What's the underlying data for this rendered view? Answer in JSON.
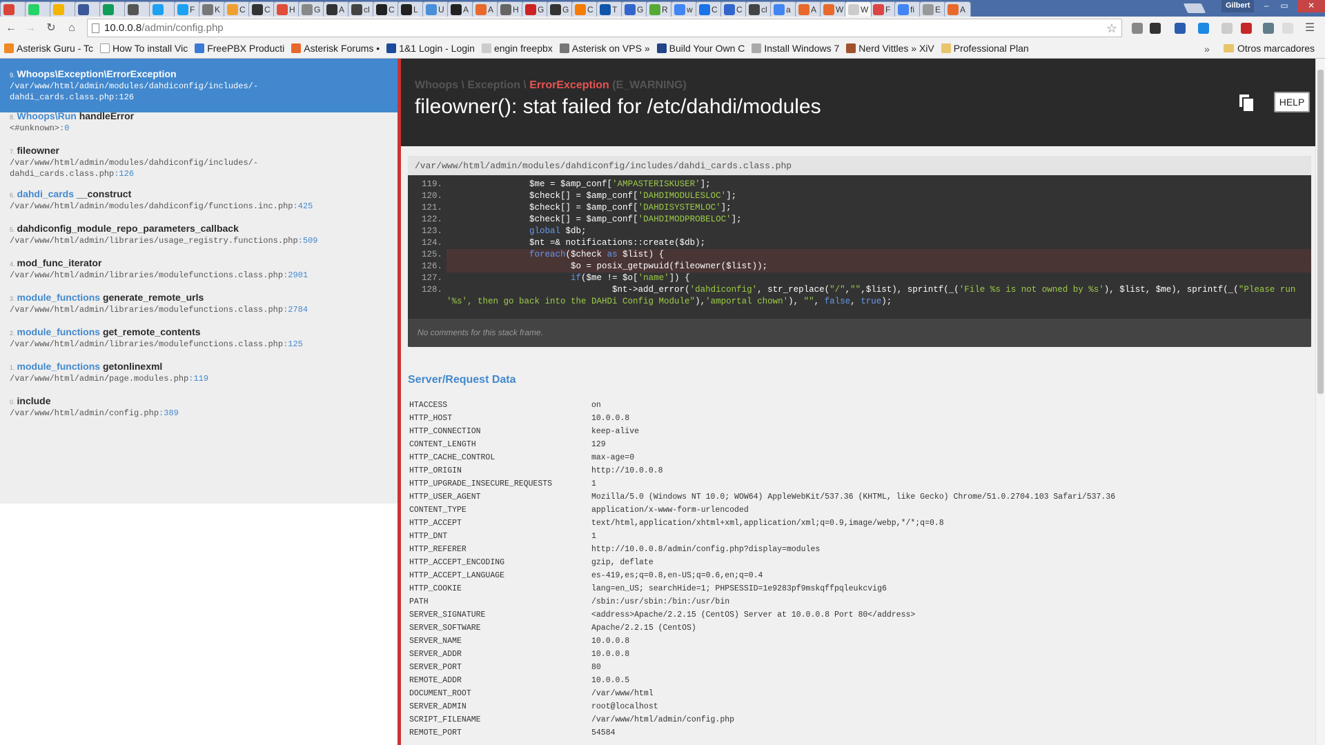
{
  "browser": {
    "profile": "Gilbert",
    "window_controls": [
      "–",
      "▭",
      "✕"
    ],
    "tabs": [
      {
        "label": "",
        "color": "#db4437"
      },
      {
        "label": "",
        "color": "#25d366"
      },
      {
        "label": "",
        "color": "#f4b400"
      },
      {
        "label": "",
        "color": "#3b5998"
      },
      {
        "label": "",
        "color": "#0f9d58"
      },
      {
        "label": "",
        "color": "#555555"
      },
      {
        "label": "",
        "color": "#1da1f2"
      },
      {
        "label": "F",
        "color": "#1da1f2"
      },
      {
        "label": "K",
        "color": "#777777"
      },
      {
        "label": "C",
        "color": "#f0a030"
      },
      {
        "label": "C",
        "color": "#333333"
      },
      {
        "label": "H",
        "color": "#e04e39"
      },
      {
        "label": "G",
        "color": "#888888"
      },
      {
        "label": "A",
        "color": "#333333"
      },
      {
        "label": "cl",
        "color": "#444444"
      },
      {
        "label": "C",
        "color": "#222222"
      },
      {
        "label": "L",
        "color": "#222222"
      },
      {
        "label": "U",
        "color": "#4a90d9"
      },
      {
        "label": "A",
        "color": "#222222"
      },
      {
        "label": "A",
        "color": "#e8692b"
      },
      {
        "label": "H",
        "color": "#666666"
      },
      {
        "label": "G",
        "color": "#cc2222"
      },
      {
        "label": "G",
        "color": "#333333"
      },
      {
        "label": "C",
        "color": "#f57c00"
      },
      {
        "label": "T",
        "color": "#1155aa"
      },
      {
        "label": "G",
        "color": "#3366cc"
      },
      {
        "label": "R",
        "color": "#55aa33"
      },
      {
        "label": "w",
        "color": "#4285f4"
      },
      {
        "label": "C",
        "color": "#1a73e8"
      },
      {
        "label": "C",
        "color": "#3366cc"
      },
      {
        "label": "cl",
        "color": "#444444"
      },
      {
        "label": "a",
        "color": "#4285f4"
      },
      {
        "label": "A",
        "color": "#e8692b"
      },
      {
        "label": "W",
        "color": "#e8692b"
      },
      {
        "label": "W",
        "color": "#cccccc",
        "active": true
      },
      {
        "label": "F",
        "color": "#dd4444"
      },
      {
        "label": "fi",
        "color": "#4285f4"
      },
      {
        "label": "E",
        "color": "#999999"
      },
      {
        "label": "A",
        "color": "#e8692b"
      }
    ],
    "url_host": "10.0.0.8",
    "url_path": "/admin/config.php",
    "bookmarks": [
      {
        "label": "Asterisk Guru - Tc",
        "color": "#f08a24"
      },
      {
        "label": "How To install Vic",
        "color": "#ffffff"
      },
      {
        "label": "FreePBX Producti",
        "color": "#3a7bd5"
      },
      {
        "label": "Asterisk Forums •",
        "color": "#e8692b"
      },
      {
        "label": "1&1 Login - Login",
        "color": "#1c4a9c"
      },
      {
        "label": "engin freepbx",
        "color": "#cccccc"
      },
      {
        "label": "Asterisk on VPS »",
        "color": "#777777"
      },
      {
        "label": "Build Your Own C",
        "color": "#224488"
      },
      {
        "label": "Install Windows 7",
        "color": "#aaaaaa"
      },
      {
        "label": "Nerd Vittles » XiV",
        "color": "#a0522d"
      },
      {
        "label": "Professional Plan",
        "color": "#e8c46a"
      }
    ],
    "bookmarks_overflow": "»",
    "other_bookmarks": "Otros marcadores"
  },
  "frames": [
    {
      "index": "9.",
      "class": "Whoops\\Exception\\ErrorException",
      "func": "",
      "file": "/var/www/html/admin/modules/dahdiconfig/includes/-",
      "file2": "dahdi_cards.class.php",
      "line": ":126"
    },
    {
      "index": "8.",
      "class": "Whoops\\Run",
      "func": " handleError",
      "file": "<#unknown>",
      "file2": "",
      "line": ":0"
    },
    {
      "index": "7.",
      "class": "",
      "func": "fileowner",
      "file": "/var/www/html/admin/modules/dahdiconfig/includes/-",
      "file2": "dahdi_cards.class.php",
      "line": ":126"
    },
    {
      "index": "6.",
      "class": "dahdi_cards",
      "func": " __construct",
      "file": "/var/www/html/admin/modules/dahdiconfig/functions.inc.php",
      "file2": "",
      "line": ":425"
    },
    {
      "index": "5.",
      "class": "",
      "func": "dahdiconfig_module_repo_parameters_callback",
      "file": "/var/www/html/admin/libraries/usage_registry.functions.php",
      "file2": "",
      "line": ":509"
    },
    {
      "index": "4.",
      "class": "",
      "func": "mod_func_iterator",
      "file": "/var/www/html/admin/libraries/modulefunctions.class.php",
      "file2": "",
      "line": ":2901"
    },
    {
      "index": "3.",
      "class": "module_functions",
      "func": " generate_remote_urls",
      "file": "/var/www/html/admin/libraries/modulefunctions.class.php",
      "file2": "",
      "line": ":2784"
    },
    {
      "index": "2.",
      "class": "module_functions",
      "func": " get_remote_contents",
      "file": "/var/www/html/admin/libraries/modulefunctions.class.php",
      "file2": "",
      "line": ":125"
    },
    {
      "index": "1.",
      "class": "module_functions",
      "func": " getonlinexml",
      "file": "/var/www/html/admin/page.modules.php",
      "file2": "",
      "line": ":119"
    },
    {
      "index": "0.",
      "class": "",
      "func": "include",
      "file": "/var/www/html/admin/config.php",
      "file2": "",
      "line": ":389"
    }
  ],
  "exception": {
    "ns": "Whoops \\ Exception \\ ",
    "name": "ErrorException",
    "level": " (E_WARNING)",
    "message": "fileowner(): stat failed for /etc/dahdi/modules",
    "help_label": "HELP"
  },
  "code": {
    "file": "/var/www/html/admin/modules/dahdiconfig/includes/dahdi_cards.class.php",
    "lines": [
      {
        "n": "119.",
        "html": "                $me = $amp_conf[<span class=\"str\">'AMPASTERISKUSER'</span>];"
      },
      {
        "n": "120.",
        "html": "                $check[] = $amp_conf[<span class=\"str\">'DAHDIMODULESLOC'</span>];"
      },
      {
        "n": "121.",
        "html": "                $check[] = $amp_conf[<span class=\"str\">'DAHDISYSTEMLOC'</span>];"
      },
      {
        "n": "122.",
        "html": "                $check[] = $amp_conf[<span class=\"str\">'DAHDIMODPROBELOC'</span>];"
      },
      {
        "n": "123.",
        "html": "                <span class=\"kw\">global</span> $db;"
      },
      {
        "n": "124.",
        "html": "                $nt =& notifications::create($db);"
      },
      {
        "n": "125.",
        "html": "                <span class=\"kw\">foreach</span>($check <span class=\"kw\">as</span> $list) {",
        "hl": true
      },
      {
        "n": "126.",
        "html": "                        $o = posix_getpwuid(fileowner($list));",
        "hl": true
      },
      {
        "n": "127.",
        "html": "                        <span class=\"kw\">if</span>($me != $o[<span class=\"str\">'name'</span>]) {"
      },
      {
        "n": "128.",
        "html": "                                $nt->add_error(<span class=\"str\">'dahdiconfig'</span>, str_replace(<span class=\"str\">\"/\"</span>,<span class=\"str\">\"\"</span>,$list), sprintf(_(<span class=\"str\">'File %s is not owned by %s'</span>), $list, $me), sprintf(_(<span class=\"str\">\"Please run '%s', then go back into the DAHDi Config Module\"</span>),<span class=\"str\">'amportal chown'</span>), <span class=\"str\">\"\"</span>, <span class=\"kw\">false</span>, <span class=\"kw\">true</span>);"
      }
    ],
    "comments": "No comments for this stack frame."
  },
  "server": {
    "title": "Server/Request Data",
    "rows": [
      [
        "HTACCESS",
        "on"
      ],
      [
        "HTTP_HOST",
        "10.0.0.8"
      ],
      [
        "HTTP_CONNECTION",
        "keep-alive"
      ],
      [
        "CONTENT_LENGTH",
        "129"
      ],
      [
        "HTTP_CACHE_CONTROL",
        "max-age=0"
      ],
      [
        "HTTP_ORIGIN",
        "http://10.0.0.8"
      ],
      [
        "HTTP_UPGRADE_INSECURE_REQUESTS",
        "1"
      ],
      [
        "HTTP_USER_AGENT",
        "Mozilla/5.0 (Windows NT 10.0; WOW64) AppleWebKit/537.36 (KHTML, like Gecko) Chrome/51.0.2704.103 Safari/537.36"
      ],
      [
        "CONTENT_TYPE",
        "application/x-www-form-urlencoded"
      ],
      [
        "HTTP_ACCEPT",
        "text/html,application/xhtml+xml,application/xml;q=0.9,image/webp,*/*;q=0.8"
      ],
      [
        "HTTP_DNT",
        "1"
      ],
      [
        "HTTP_REFERER",
        "http://10.0.0.8/admin/config.php?display=modules"
      ],
      [
        "HTTP_ACCEPT_ENCODING",
        "gzip, deflate"
      ],
      [
        "HTTP_ACCEPT_LANGUAGE",
        "es-419,es;q=0.8,en-US;q=0.6,en;q=0.4"
      ],
      [
        "HTTP_COOKIE",
        "lang=en_US; searchHide=1; PHPSESSID=1e9283pf9mskqffpqleukcvig6"
      ],
      [
        "PATH",
        "/sbin:/usr/sbin:/bin:/usr/bin"
      ],
      [
        "SERVER_SIGNATURE",
        "<address>Apache/2.2.15 (CentOS) Server at 10.0.0.8 Port 80</address>"
      ],
      [
        "SERVER_SOFTWARE",
        "Apache/2.2.15 (CentOS)"
      ],
      [
        "SERVER_NAME",
        "10.0.0.8"
      ],
      [
        "SERVER_ADDR",
        "10.0.0.8"
      ],
      [
        "SERVER_PORT",
        "80"
      ],
      [
        "REMOTE_ADDR",
        "10.0.0.5"
      ],
      [
        "DOCUMENT_ROOT",
        "/var/www/html"
      ],
      [
        "SERVER_ADMIN",
        "root@localhost"
      ],
      [
        "SCRIPT_FILENAME",
        "/var/www/html/admin/config.php"
      ],
      [
        "REMOTE_PORT",
        "54584"
      ]
    ]
  },
  "colors": {
    "accent": "#4288ce",
    "error_red": "#e95353",
    "header_bg": "#2a2a2a"
  }
}
